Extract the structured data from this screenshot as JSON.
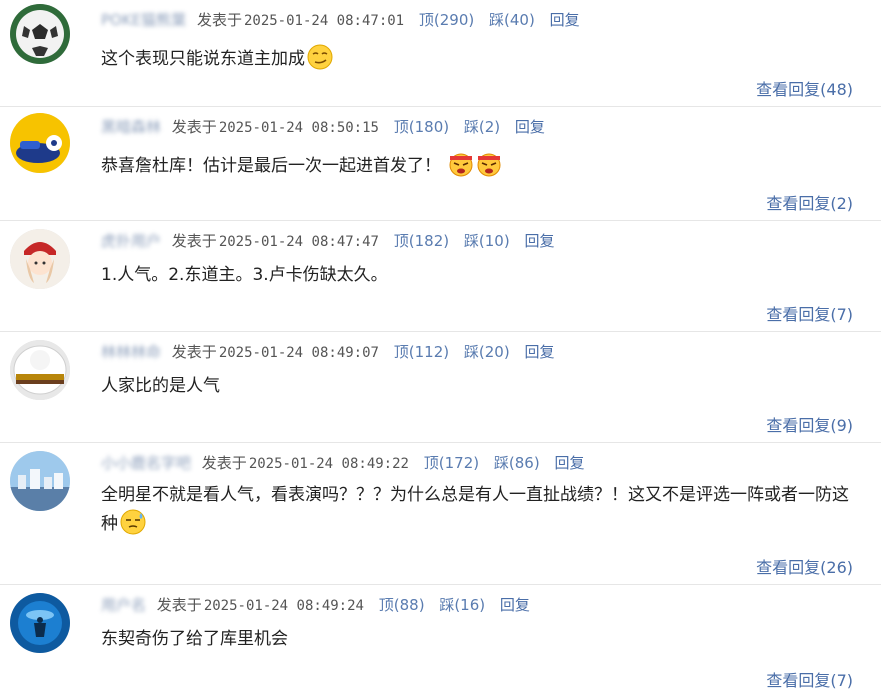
{
  "comments": [
    {
      "username": "POKE猫熊葉",
      "posted_label": "发表于",
      "time": "2025-01-24 08:47:01",
      "up": "顶(290)",
      "down": "踩(40)",
      "reply": "回复",
      "content": "这个表现只能说东道主加成",
      "emojis": [
        "smirk-emoji-icon"
      ],
      "view_replies": "查看回复(48)",
      "avatar": "soccer-ball-avatar"
    },
    {
      "username": "黑暗森林",
      "posted_label": "发表于",
      "time": "2025-01-24 08:50:15",
      "up": "顶(180)",
      "down": "踩(2)",
      "reply": "回复",
      "content": "恭喜詹杜库！估计是最后一次一起进首发了！",
      "emojis": [
        "angry-emoji-icon",
        "angry-emoji-icon"
      ],
      "view_replies": "查看回复(2)",
      "avatar": "cartoon-avatar"
    },
    {
      "username": "虎扑用户",
      "posted_label": "发表于",
      "time": "2025-01-24 08:47:47",
      "up": "顶(182)",
      "down": "踩(10)",
      "reply": "回复",
      "content": "1.人气。2.东道主。3.卢卡伤缺太久。",
      "emojis": [],
      "view_replies": "查看回复(7)",
      "avatar": "anime-girl-avatar"
    },
    {
      "username": "林林林命",
      "posted_label": "发表于",
      "time": "2025-01-24 08:49:07",
      "up": "顶(112)",
      "down": "踩(20)",
      "reply": "回复",
      "content": "人家比的是人气",
      "emojis": [],
      "view_replies": "查看回复(9)",
      "avatar": "fluffy-avatar"
    },
    {
      "username": "小小鹿名字吧",
      "posted_label": "发表于",
      "time": "2025-01-24 08:49:22",
      "up": "顶(172)",
      "down": "踩(86)",
      "reply": "回复",
      "content": "全明星不就是看人气，看表演吗？？？为什么总是有人一直扯战绩？！这又不是评选一阵或者一防这种",
      "emojis": [
        "sweat-emoji-icon"
      ],
      "view_replies": "查看回复(26)",
      "avatar": "city-avatar"
    },
    {
      "username": "用户名",
      "posted_label": "发表于",
      "time": "2025-01-24 08:49:24",
      "up": "顶(88)",
      "down": "踩(16)",
      "reply": "回复",
      "content": "东契奇伤了给了库里机会",
      "emojis": [],
      "view_replies": "查看回复(7)",
      "avatar": "underwater-avatar"
    }
  ]
}
